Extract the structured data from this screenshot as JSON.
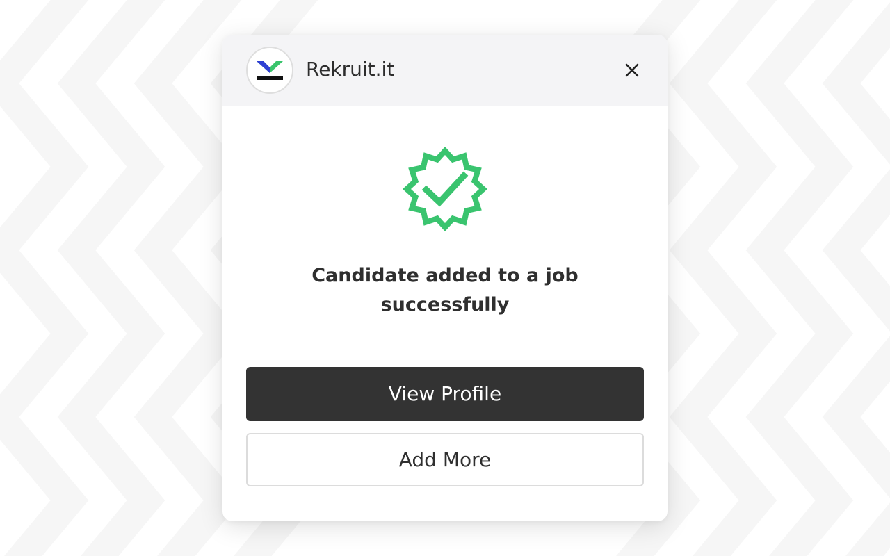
{
  "app": {
    "name": "Rekruit.it",
    "logo_icon": "rekruit-logo-icon"
  },
  "header": {
    "close_icon": "close-icon"
  },
  "status": {
    "icon": "verified-badge-icon",
    "message": "Candidate added to a job successfully"
  },
  "actions": {
    "primary_label": "View Profile",
    "secondary_label": "Add More"
  },
  "colors": {
    "success": "#3ac46f",
    "logo_blue": "#2f3fd4",
    "logo_green": "#39c46c",
    "primary_button": "#333333",
    "header_bg": "#f4f4f6"
  }
}
